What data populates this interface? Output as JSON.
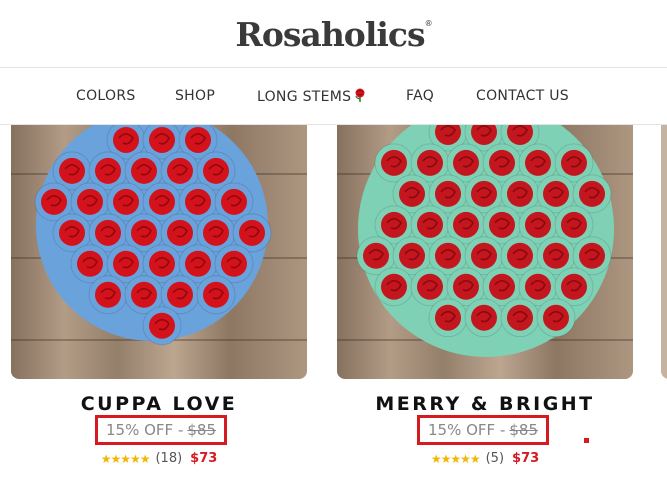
{
  "brand": {
    "logo_text": "Rosaholics",
    "registered_mark": "®"
  },
  "nav": {
    "items": [
      {
        "label": "COLORS"
      },
      {
        "label": "SHOP"
      },
      {
        "label": "LONG STEMS"
      },
      {
        "label": "FAQ"
      },
      {
        "label": "CONTACT US"
      }
    ]
  },
  "products": [
    {
      "title": "CUPPA LOVE",
      "discount_text": "15% OFF -",
      "original_price": "$85",
      "rating_count": "(18)",
      "sale_price": "$73",
      "petal_color": "#6aa2dc",
      "rose_color": "#d3121c"
    },
    {
      "title": "MERRY & BRIGHT",
      "discount_text": "15% OFF -",
      "original_price": "$85",
      "rating_count": "(5)",
      "sale_price": "$73",
      "petal_color": "#7fd1b6",
      "rose_color": "#c4161e"
    }
  ],
  "colors": {
    "accent_red": "#d71920",
    "star": "#f2b705",
    "text_muted": "#888888"
  }
}
